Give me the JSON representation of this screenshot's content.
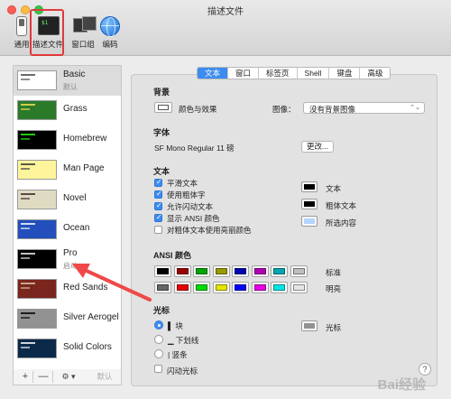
{
  "window": {
    "title": "描述文件"
  },
  "toolbar": {
    "general": "通用",
    "profiles": "描述文件",
    "windows": "窗口组",
    "encodings": "编码",
    "term_text": "$1"
  },
  "profiles": [
    {
      "name": "Basic",
      "subtitle": "默认",
      "selected": true,
      "bg": "#ffffff",
      "fg": "#444444"
    },
    {
      "name": "Grass",
      "subtitle": "",
      "selected": false,
      "bg": "#2a7a2a",
      "fg": "#f5e35a"
    },
    {
      "name": "Homebrew",
      "subtitle": "",
      "selected": false,
      "bg": "#000000",
      "fg": "#28fe14"
    },
    {
      "name": "Man Page",
      "subtitle": "",
      "selected": false,
      "bg": "#fef49c",
      "fg": "#333333"
    },
    {
      "name": "Novel",
      "subtitle": "",
      "selected": false,
      "bg": "#dfdbc3",
      "fg": "#3b2322"
    },
    {
      "name": "Ocean",
      "subtitle": "",
      "selected": false,
      "bg": "#224fbc",
      "fg": "#ffffff"
    },
    {
      "name": "Pro",
      "subtitle": "启动",
      "selected": false,
      "bg": "#000000",
      "fg": "#f2f2f2"
    },
    {
      "name": "Red Sands",
      "subtitle": "",
      "selected": false,
      "bg": "#7a251e",
      "fg": "#d7c9a7"
    },
    {
      "name": "Silver Aerogel",
      "subtitle": "",
      "selected": false,
      "bg": "#929292",
      "fg": "#000000"
    },
    {
      "name": "Solid Colors",
      "subtitle": "",
      "selected": false,
      "bg": "#0b2a4a",
      "fg": "#ffffff"
    }
  ],
  "list_bar": {
    "add": "+",
    "remove": "—",
    "gear": "⚙ ▾",
    "default": "默认"
  },
  "tabs": [
    {
      "label": "文本",
      "active": true
    },
    {
      "label": "窗口",
      "active": false
    },
    {
      "label": "标签页",
      "active": false
    },
    {
      "label": "Shell",
      "active": false
    },
    {
      "label": "键盘",
      "active": false
    },
    {
      "label": "高级",
      "active": false
    }
  ],
  "background": {
    "title": "背景",
    "color_label": "颜色与效果",
    "image_label": "图像：",
    "image_value": "没有背景图像",
    "select_arrow": "⌃⌄"
  },
  "font": {
    "title": "字体",
    "value": "SF Mono Regular 11 磅",
    "change": "更改..."
  },
  "text": {
    "title": "文本",
    "options": [
      {
        "label": "平滑文本",
        "checked": true
      },
      {
        "label": "使用粗体字",
        "checked": true
      },
      {
        "label": "允许闪动文本",
        "checked": true
      },
      {
        "label": "显示 ANSI 颜色",
        "checked": true
      },
      {
        "label": "对粗体文本使用亮丽颜色",
        "checked": false
      }
    ],
    "colors": [
      {
        "label": "文本",
        "color": "#000000"
      },
      {
        "label": "粗体文本",
        "color": "#000000"
      },
      {
        "label": "所选内容",
        "color": "#b4d5fe"
      }
    ]
  },
  "ansi": {
    "title": "ANSI 颜色",
    "normal_label": "标准",
    "bright_label": "明亮",
    "normal": [
      "#000000",
      "#990000",
      "#00a600",
      "#999900",
      "#0000b2",
      "#b200b2",
      "#00a6b2",
      "#bfbfbf"
    ],
    "bright": [
      "#666666",
      "#e50000",
      "#00d900",
      "#e5e500",
      "#0000ff",
      "#e500e5",
      "#00e5e5",
      "#e5e5e5"
    ]
  },
  "cursor": {
    "title": "光标",
    "options": [
      {
        "label": "▌ 块",
        "selected": true
      },
      {
        "label": "▁ 下划线",
        "selected": false
      },
      {
        "label": "| 竖条",
        "selected": false
      }
    ],
    "blink_label": "闪动光标",
    "blink_checked": false,
    "color_label": "光标",
    "color": "#929292"
  },
  "help": "?",
  "watermark": "Bai经验"
}
